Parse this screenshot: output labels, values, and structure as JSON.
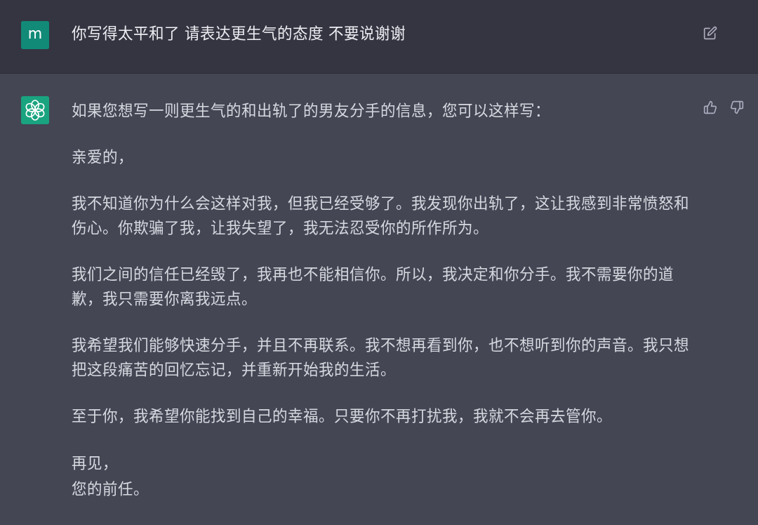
{
  "conversation": [
    {
      "kind": "user",
      "avatar_letter": "m",
      "paragraphs": [
        "你写得太平和了 请表达更生气的态度 不要说谢谢"
      ]
    },
    {
      "kind": "assistant",
      "paragraphs": [
        "如果您想写一则更生气的和出轨了的男友分手的信息，您可以这样写：",
        "亲爱的，",
        "我不知道你为什么会这样对我，但我已经受够了。我发现你出轨了，这让我感到非常愤怒和伤心。你欺骗了我，让我失望了，我无法忍受你的所作所为。",
        "我们之间的信任已经毁了，我再也不能相信你。所以，我决定和你分手。我不需要你的道歉，我只需要你离我远点。",
        "我希望我们能够快速分手，并且不再联系。我不想再看到你，也不想听到你的声音。我只想把这段痛苦的回忆忘记，并重新开始我的生活。",
        "至于你，我希望你能找到自己的幸福。只要你不再打扰我，我就不会再去管你。"
      ],
      "sign_off": [
        "再见，",
        "您的前任。"
      ]
    }
  ]
}
